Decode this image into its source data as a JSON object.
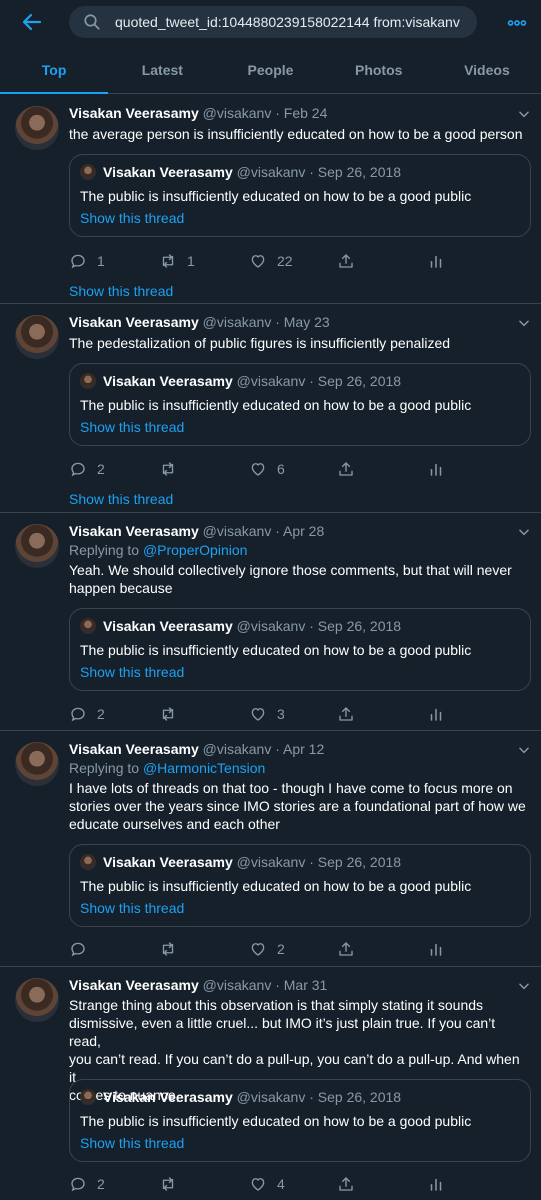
{
  "search": {
    "query": "quoted_tweet_id:1044880239158022144 from:visakanv"
  },
  "tabs": [
    {
      "label": "Top"
    },
    {
      "label": "Latest"
    },
    {
      "label": "People"
    },
    {
      "label": "Photos"
    },
    {
      "label": "Videos"
    }
  ],
  "colors": {
    "accent": "#1da1f2",
    "background": "#15202b",
    "muted": "#8899a6",
    "border": "#38444d"
  },
  "quoted": {
    "name": "Visakan Veerasamy",
    "meta": "@visakanv · Sep 26, 2018",
    "text": "The public is insufficiently educated on how to be a good public",
    "thread_link": "Show this thread"
  },
  "tweets": [
    {
      "name": "Visakan Veerasamy",
      "meta": "@visakanv · Feb 24",
      "lines": [
        "the average person is insufficiently educated on how to be a good person"
      ],
      "replies": "1",
      "retweets": "1",
      "likes": "22",
      "show_thread": "Show this thread"
    },
    {
      "name": "Visakan Veerasamy",
      "meta": "@visakanv · May 23",
      "lines": [
        "The pedestalization of public figures is insufficiently penalized"
      ],
      "replies": "2",
      "retweets": "",
      "likes": "6",
      "show_thread": "Show this thread"
    },
    {
      "name": "Visakan Veerasamy",
      "meta": "@visakanv · Apr 28",
      "replying_label": "Replying to",
      "replying_handle": "@ProperOpinion",
      "lines": [
        "Yeah. We should collectively ignore those comments, but that will never",
        "happen because"
      ],
      "replies": "2",
      "retweets": "",
      "likes": "3"
    },
    {
      "name": "Visakan Veerasamy",
      "meta": "@visakanv · Apr 12",
      "replying_label": "Replying to",
      "replying_handle": "@HarmonicTension",
      "lines": [
        "I have lots of threads on that too - though I have come to focus more on",
        "stories over the years since IMO stories are a foundational part of how we",
        "educate ourselves and each other"
      ],
      "replies": "",
      "retweets": "",
      "likes": "2"
    },
    {
      "name": "Visakan Veerasamy",
      "meta": "@visakanv · Mar 31",
      "lines": [
        "Strange thing about this observation is that simply stating it sounds",
        "dismissive, even a little cruel... but IMO it’s just plain true. If you can’t read,",
        "you can’t read. If you can’t do a pull-up, you can’t do a pull-up. And when it",
        "comes to nuance,"
      ],
      "replies": "2",
      "retweets": "",
      "likes": "4"
    }
  ]
}
